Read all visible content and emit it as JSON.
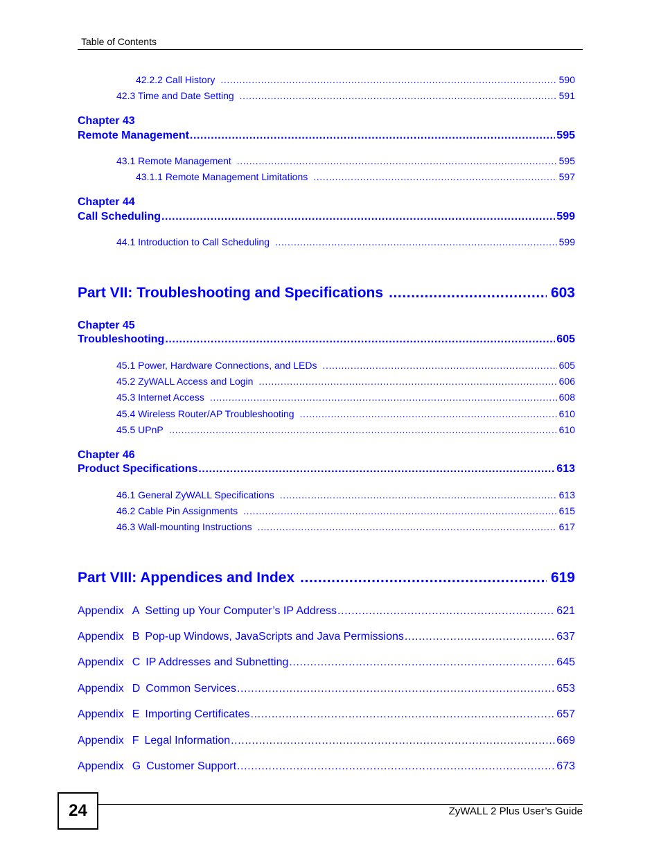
{
  "header": {
    "title": "Table of Contents"
  },
  "toc": {
    "pre_entries": [
      {
        "label": "42.2.2 Call History",
        "page": "590"
      },
      {
        "label": "42.3 Time and Date Setting",
        "page": "591"
      }
    ],
    "chapters": [
      {
        "chapter_label": "Chapter  43",
        "title": "Remote Management",
        "page": "595",
        "sections": [
          {
            "label": "43.1 Remote Management",
            "page": "595"
          },
          {
            "label": "43.1.1 Remote Management Limitations",
            "page": "597"
          }
        ]
      },
      {
        "chapter_label": "Chapter  44",
        "title": "Call Scheduling",
        "page": "599",
        "sections": [
          {
            "label": "44.1 Introduction to Call Scheduling",
            "page": "599"
          }
        ]
      },
      {
        "chapter_label": "Chapter  45",
        "title": "Troubleshooting",
        "page": "605",
        "sections": [
          {
            "label": "45.1 Power, Hardware Connections, and LEDs",
            "page": "605"
          },
          {
            "label": "45.2 ZyWALL Access and Login",
            "page": "606"
          },
          {
            "label": "45.3 Internet Access",
            "page": "608"
          },
          {
            "label": "45.4 Wireless Router/AP Troubleshooting",
            "page": "610"
          },
          {
            "label": "45.5 UPnP",
            "page": "610"
          }
        ]
      },
      {
        "chapter_label": "Chapter  46",
        "title": "Product Specifications",
        "page": "613",
        "sections": [
          {
            "label": "46.1 General ZyWALL Specifications",
            "page": "613"
          },
          {
            "label": "46.2 Cable Pin Assignments",
            "page": "615"
          },
          {
            "label": "46.3 Wall-mounting Instructions",
            "page": "617"
          }
        ]
      }
    ],
    "parts": [
      {
        "label": "Part VII: Troubleshooting and Specifications",
        "page": "603"
      },
      {
        "label": "Part VIII: Appendices and Index",
        "page": "619"
      }
    ],
    "appendices": [
      {
        "prefix": "Appendix",
        "letter": "A",
        "title": "Setting up Your Computer’s IP Address",
        "page": "621"
      },
      {
        "prefix": "Appendix",
        "letter": "B",
        "title": "Pop-up Windows, JavaScripts and Java Permissions",
        "page": "637"
      },
      {
        "prefix": "Appendix",
        "letter": "C",
        "title": "IP Addresses and Subnetting",
        "page": "645"
      },
      {
        "prefix": "Appendix",
        "letter": "D",
        "title": "Common Services",
        "page": "653"
      },
      {
        "prefix": "Appendix",
        "letter": "E",
        "title": "Importing Certificates",
        "page": "657"
      },
      {
        "prefix": "Appendix",
        "letter": "F",
        "title": "Legal Information",
        "page": "669"
      },
      {
        "prefix": "Appendix",
        "letter": "G",
        "title": "Customer Support",
        "page": "673"
      }
    ]
  },
  "footer": {
    "page_number": "24",
    "guide_title": "ZyWALL 2 Plus User’s Guide"
  },
  "colors": {
    "link": "#0000ff",
    "text": "#000000"
  }
}
